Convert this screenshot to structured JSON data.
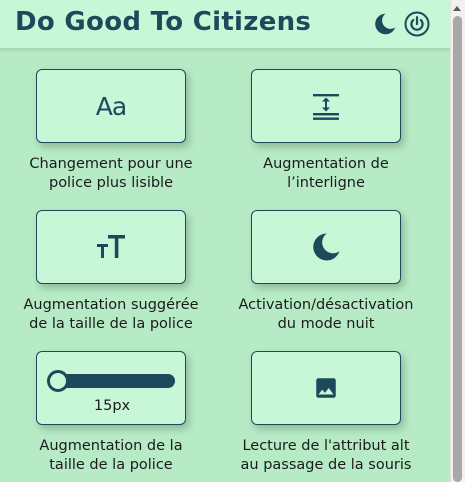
{
  "header": {
    "title": "Do Good To Citizens",
    "night_mode_icon": "moon-icon",
    "power_icon": "power-icon"
  },
  "features": [
    {
      "icon": "font-aa-icon",
      "icon_text": "Aa",
      "label_line1": "Changement pour une",
      "label_line2": "police plus lisible"
    },
    {
      "icon": "line-spacing-icon",
      "label_line1": "Augmentation de",
      "label_line2": "l’interligne"
    },
    {
      "icon": "text-size-icon",
      "label_line1": "Augmentation suggérée",
      "label_line2": "de la taille de la police"
    },
    {
      "icon": "moon-icon",
      "label_line1": "Activation/désactivation",
      "label_line2": "du mode nuit"
    },
    {
      "icon": "slider-icon",
      "slider_value": "15px",
      "slider_level": 0,
      "label_line1": "Augmentation de la",
      "label_line2": "taille de la police"
    },
    {
      "icon": "image-icon",
      "label_line1": "Lecture de l'attribut alt",
      "label_line2": "au passage de la souris"
    }
  ],
  "colors": {
    "background": "#b6ebc6",
    "card": "#c8f7d7",
    "accent": "#1c4a5a"
  }
}
